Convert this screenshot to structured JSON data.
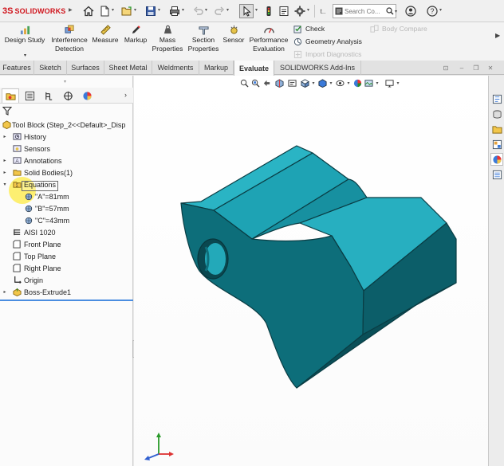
{
  "app": {
    "logo_ds": "3S",
    "logo_name": "SOLIDWORKS",
    "search_placeholder": "Search Co..."
  },
  "quick_access": [
    {
      "name": "home-icon"
    },
    {
      "name": "new-document-icon"
    },
    {
      "name": "open-folder-icon"
    },
    {
      "name": "save-icon"
    },
    {
      "name": "print-icon"
    },
    {
      "name": "undo-icon"
    },
    {
      "name": "redo-icon"
    },
    {
      "name": "select-pointer-icon"
    },
    {
      "name": "traffic-light-icon"
    },
    {
      "name": "file-properties-icon"
    },
    {
      "name": "options-gear-icon"
    },
    {
      "name": "help-icon"
    },
    {
      "name": "user-account-icon"
    },
    {
      "name": "question-icon"
    }
  ],
  "command_manager": {
    "design_study": "Design Study",
    "interference_detection": [
      "Interference",
      "Detection"
    ],
    "measure": "Measure",
    "markup": "Markup",
    "mass_properties": [
      "Mass",
      "Properties"
    ],
    "section_properties": [
      "Section",
      "Properties"
    ],
    "sensor": "Sensor",
    "performance_evaluation": [
      "Performance",
      "Evaluation"
    ],
    "check": "Check",
    "geometry_analysis": "Geometry Analysis",
    "import_diagnostics": "Import Diagnostics",
    "body_compare": "Body Compare"
  },
  "tabs": [
    "Features",
    "Sketch",
    "Surfaces",
    "Sheet Metal",
    "Weldments",
    "Markup",
    "Evaluate",
    "SOLIDWORKS Add-Ins"
  ],
  "active_tab": "Evaluate",
  "tree": {
    "root": "Tool Block  (Step_2<<Default>_Disp",
    "items": [
      {
        "label": "History",
        "icon": "history-folder-icon",
        "expandable": true
      },
      {
        "label": "Sensors",
        "icon": "sensors-icon",
        "expandable": false
      },
      {
        "label": "Annotations",
        "icon": "annotations-icon",
        "expandable": true
      },
      {
        "label": "Solid Bodies(1)",
        "icon": "solid-bodies-folder-icon",
        "expandable": true
      },
      {
        "label": "Equations",
        "icon": "equations-folder-icon",
        "expandable": true,
        "expanded": true
      },
      {
        "label": "\"A\"=81mm",
        "icon": "global-variable-icon",
        "child": true
      },
      {
        "label": "\"B\"=57mm",
        "icon": "global-variable-icon",
        "child": true
      },
      {
        "label": "\"C\"=43mm",
        "icon": "global-variable-icon",
        "child": true
      },
      {
        "label": "AISI 1020",
        "icon": "material-icon",
        "expandable": false
      },
      {
        "label": "Front Plane",
        "icon": "plane-icon",
        "expandable": false
      },
      {
        "label": "Top Plane",
        "icon": "plane-icon",
        "expandable": false
      },
      {
        "label": "Right Plane",
        "icon": "plane-icon",
        "expandable": false
      },
      {
        "label": "Origin",
        "icon": "origin-icon",
        "expandable": false
      },
      {
        "label": "Boss-Extrude1",
        "icon": "boss-extrude-icon",
        "expandable": true
      }
    ]
  },
  "colors": {
    "model_top": "#1aa6b7",
    "model_front": "#0f6b76",
    "model_side": "#0c5a64",
    "accent_blue": "#2f6fd0",
    "logo_red": "#d0141c"
  }
}
